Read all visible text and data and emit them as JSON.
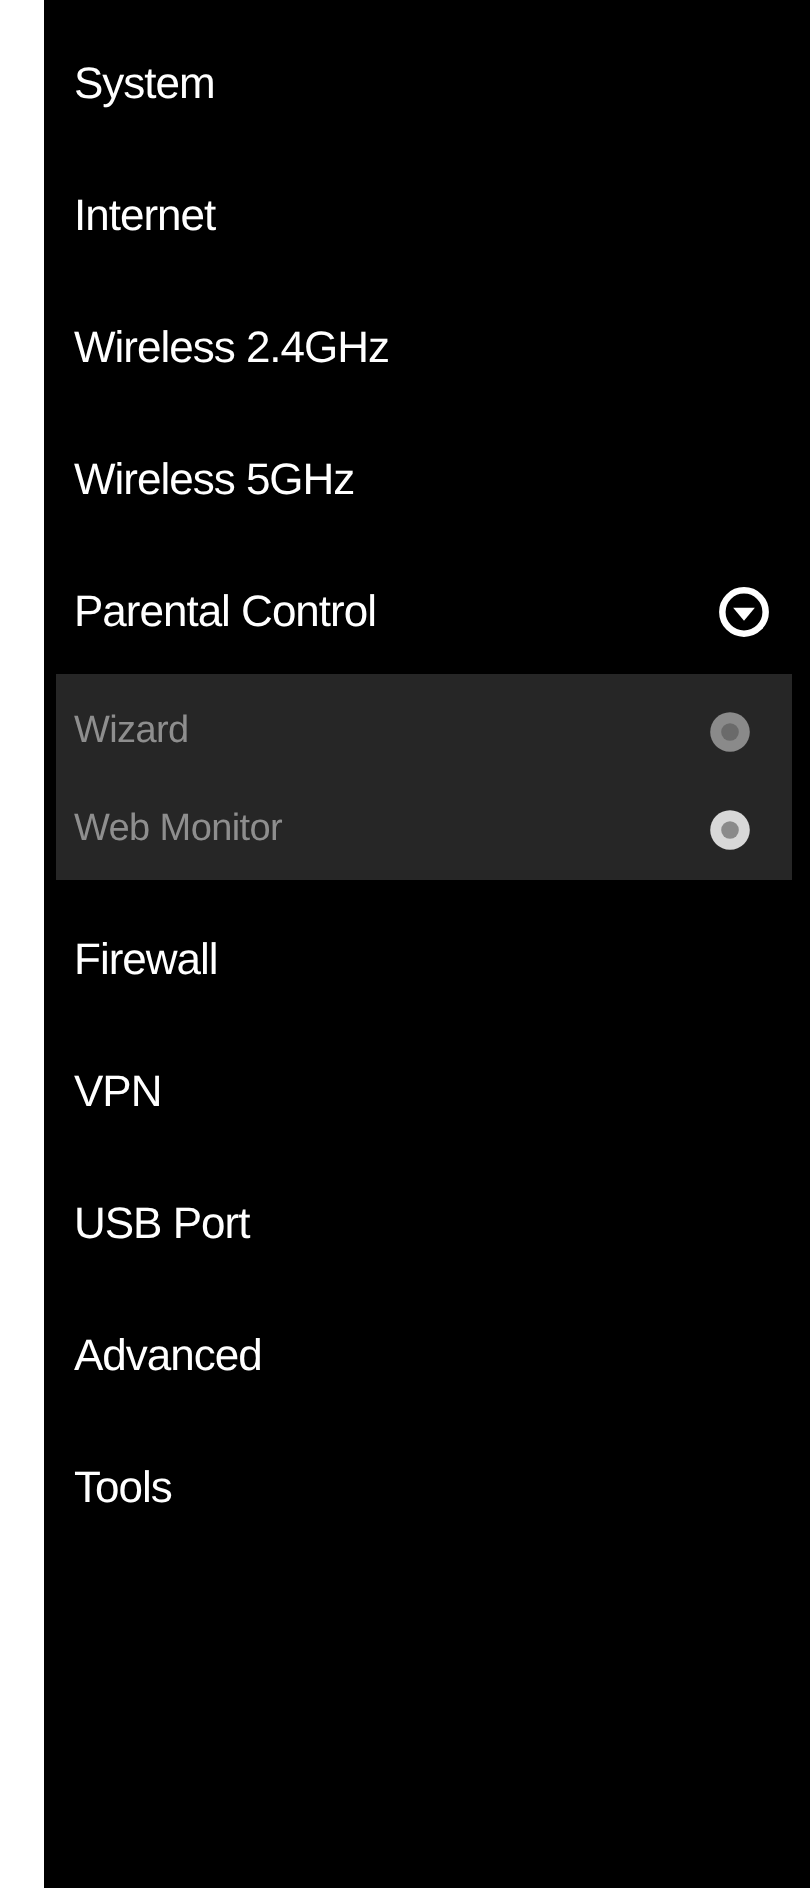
{
  "menu": [
    {
      "label": "System"
    },
    {
      "label": "Internet"
    },
    {
      "label": "Wireless 2.4GHz"
    },
    {
      "label": "Wireless 5GHz"
    },
    {
      "label": "Parental Control",
      "expanded": true,
      "children": [
        {
          "label": "Wizard",
          "selected": false
        },
        {
          "label": "Web Monitor",
          "selected": true
        }
      ]
    },
    {
      "label": "Firewall"
    },
    {
      "label": "VPN"
    },
    {
      "label": "USB Port"
    },
    {
      "label": "Advanced"
    },
    {
      "label": "Tools"
    }
  ]
}
